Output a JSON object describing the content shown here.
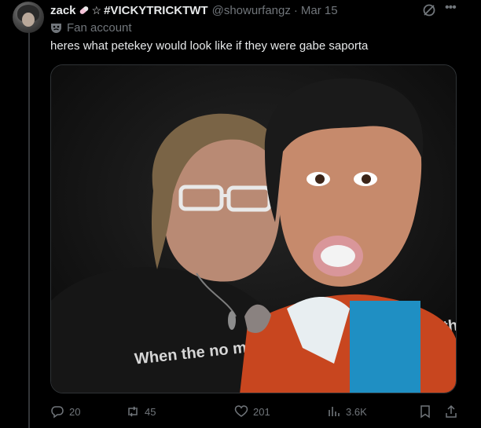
{
  "author": {
    "display_name": "zack",
    "hashtag_name": "#VICKYTRICKTWT",
    "handle": "@showurfangz",
    "separator": "·",
    "date": "Mar 15",
    "label": "Fan account"
  },
  "tweet": {
    "text": "heres what petekey would look like if they were gabe saporta",
    "image_text": "When the  no m    oom in  the dead will walk the"
  },
  "actions": {
    "replies": "20",
    "reposts": "45",
    "likes": "201",
    "views": "3.6K"
  },
  "icons": [
    "avatar",
    "pill-emoji-icon",
    "star-icon",
    "grok-icon",
    "more-icon",
    "mask-icon",
    "reply-icon",
    "retweet-icon",
    "like-icon",
    "views-icon",
    "bookmark-icon",
    "share-icon"
  ],
  "colors": {
    "background": "#000000",
    "text": "#e7e9ea",
    "secondary": "#71767b",
    "divider": "#333639"
  }
}
